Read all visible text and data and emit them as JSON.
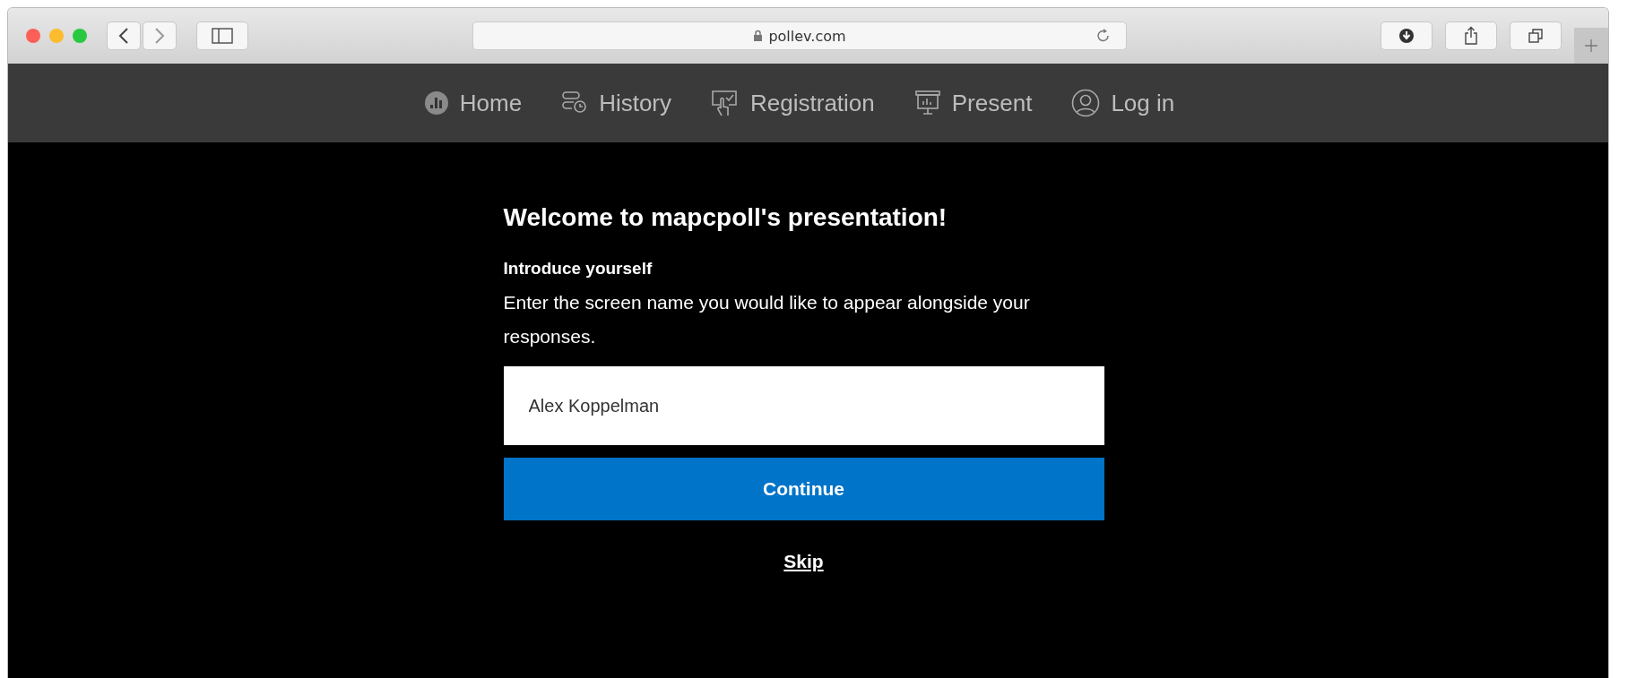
{
  "browser": {
    "address": "pollev.com"
  },
  "nav": [
    {
      "label": "Home"
    },
    {
      "label": "History"
    },
    {
      "label": "Registration"
    },
    {
      "label": "Present"
    },
    {
      "label": "Log in"
    }
  ],
  "form": {
    "title": "Welcome to mapcpoll's presentation!",
    "subtitle": "Introduce yourself",
    "description": "Enter the screen name you would like to appear alongside your responses.",
    "name_field": {
      "value": "Alex Koppelman"
    },
    "submit": "Continue",
    "skip": "Skip"
  }
}
